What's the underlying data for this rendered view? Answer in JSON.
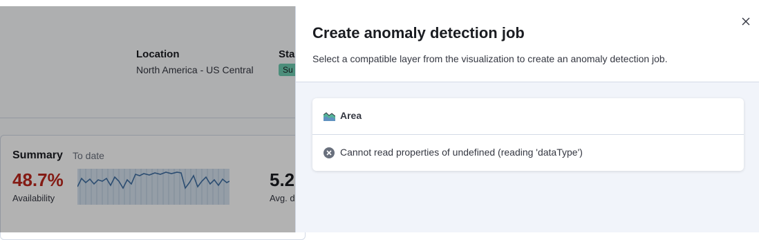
{
  "background": {
    "location": {
      "title": "Location",
      "value": "North America - US Central"
    },
    "status": {
      "title": "Sta",
      "badge": "Su",
      "badge_color": "#6dccb1"
    },
    "summary": {
      "title": "Summary",
      "subtitle": "To date",
      "availability_value": "48.7%",
      "availability_label": "Availability",
      "avg_value": "5.2",
      "avg_label": "Avg. d"
    }
  },
  "flyout": {
    "title": "Create anomaly detection job",
    "description": "Select a compatible layer from the visualization to create an anomaly detection job.",
    "close_icon": "close-icon",
    "layer": {
      "type_label": "Area",
      "type_icon": "area-chart-icon",
      "error_icon": "error-icon",
      "error_message": "Cannot read properties of undefined (reading 'dataType')"
    }
  },
  "colors": {
    "error": "#bd271e",
    "accent": "#54b399",
    "overlay": "rgba(0,0,0,0.30)"
  }
}
